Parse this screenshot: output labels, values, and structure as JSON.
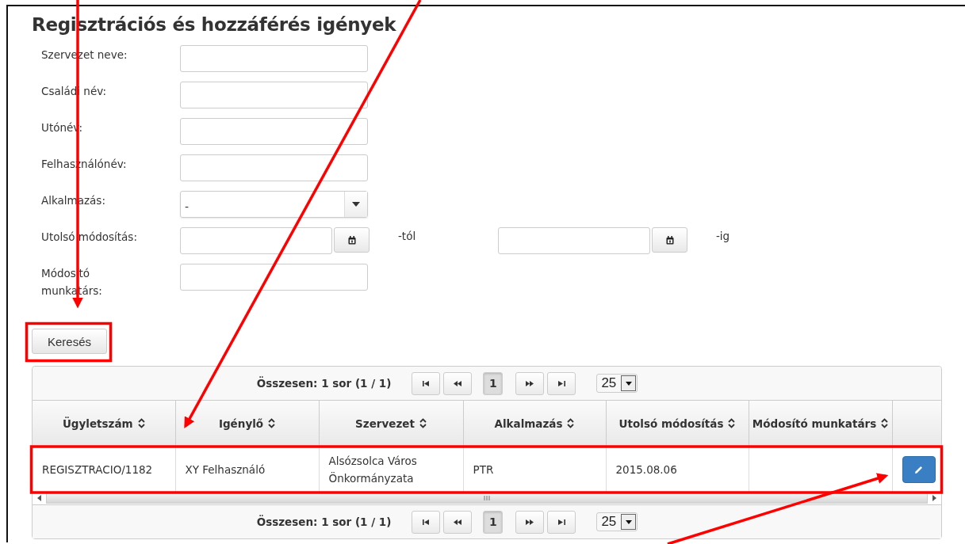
{
  "page": {
    "title": "Regisztrációs és hozzáférés igények"
  },
  "form": [
    {
      "kind": "text",
      "label": "Szervezet neve:"
    },
    {
      "kind": "text",
      "label": "Családi név:"
    },
    {
      "kind": "text",
      "label": "Utónév:"
    },
    {
      "kind": "text",
      "label": "Felhasználónév:"
    },
    {
      "kind": "select",
      "label": "Alkalmazás:",
      "value": "-"
    },
    {
      "kind": "daterange",
      "label": "Utolsó módosítás:",
      "from_suffix": "-tól",
      "to_suffix": "-ig"
    },
    {
      "kind": "text",
      "label": "Módosító munkatárs:"
    }
  ],
  "search_button": "Keresés",
  "pager_top": {
    "summary": "Összesen: 1 sor (1 / 1)",
    "page": "1",
    "page_size": "25"
  },
  "table": {
    "columns": [
      {
        "label": "Ügyletszám",
        "sortable": true
      },
      {
        "label": "Igénylő",
        "sortable": true
      },
      {
        "label": "Szervezet",
        "sortable": true
      },
      {
        "label": "Alkalmazás",
        "sortable": true
      },
      {
        "label": "Utolsó módosítás",
        "sortable": true
      },
      {
        "label": "Módosító munkatárs",
        "sortable": true
      },
      {
        "sortable": false
      }
    ],
    "rows": [
      {
        "cells": [
          "REGISZTRACIO/1182",
          "XY Felhasználó",
          "Alsózsolca Város Önkormányzata",
          "PTR",
          "2015.08.06"
        ],
        "editable": true
      }
    ]
  },
  "pager_bottom": {
    "summary": "Összesen: 1 sor (1 / 1)",
    "page": "1",
    "page_size": "25"
  }
}
